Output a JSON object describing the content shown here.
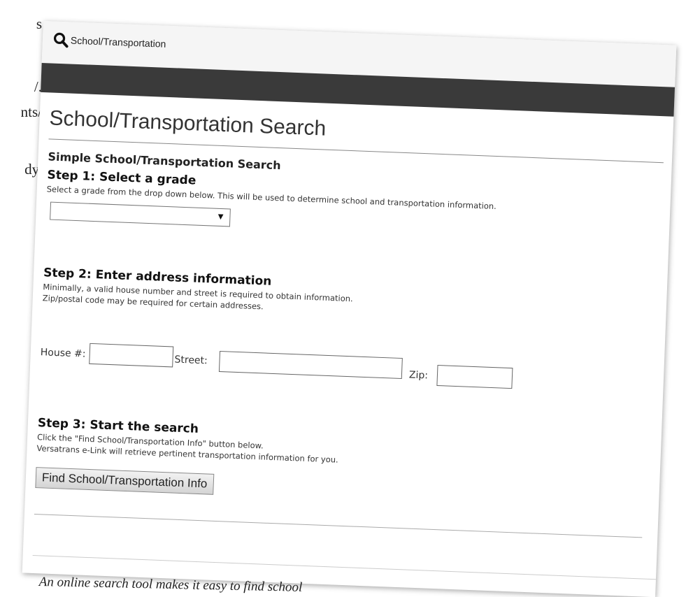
{
  "margin_fragments": [
    "s",
    "/.",
    "nts/",
    "dy,"
  ],
  "header": {
    "app_title": "School/Transportation"
  },
  "page": {
    "title": "School/Transportation Search",
    "section_title": "Simple School/Transportation Search"
  },
  "step1": {
    "title": "Step 1: Select a grade",
    "description": "Select a grade from the drop down below. This will be used to determine school and transportation information.",
    "grade_value": ""
  },
  "step2": {
    "title": "Step 2: Enter address information",
    "description_line1": "Minimally, a valid house number and street is required to obtain information.",
    "description_line2": "Zip/postal code may be required for certain addresses.",
    "house_label": "House #:",
    "street_label": "Street:",
    "zip_label": "Zip:",
    "house_value": "",
    "street_value": "",
    "zip_value": ""
  },
  "step3": {
    "title": "Step 3: Start the search",
    "description_line1": "Click the \"Find School/Transportation Info\" button below.",
    "description_line2": "Versatrans e-Link will retrieve pertinent transportation information for you.",
    "button_label": "Find School/Transportation Info"
  },
  "caption": "An online search tool makes it easy to find school",
  "icons": {
    "search": "search-icon",
    "dropdown": "chevron-down-icon"
  },
  "colors": {
    "nav_bar": "#3a3a3a",
    "top_bar": "#f5f5f5"
  }
}
